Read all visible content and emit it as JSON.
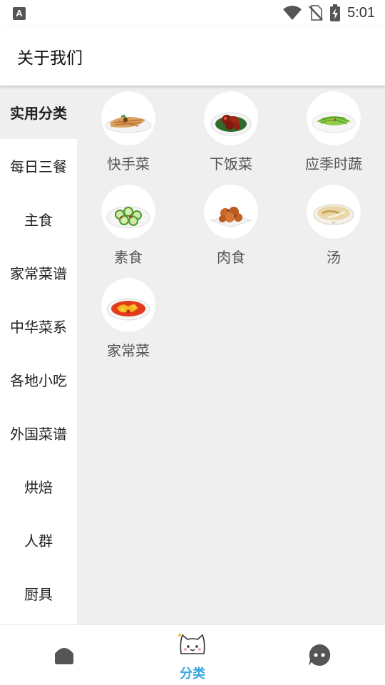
{
  "status": {
    "time": "5:01",
    "notification": "A"
  },
  "appbar": {
    "title": "关于我们"
  },
  "sidebar": {
    "items": [
      {
        "label": "实用分类",
        "active": true
      },
      {
        "label": "每日三餐",
        "active": false
      },
      {
        "label": "主食",
        "active": false
      },
      {
        "label": "家常菜谱",
        "active": false
      },
      {
        "label": "中华菜系",
        "active": false
      },
      {
        "label": "各地小吃",
        "active": false
      },
      {
        "label": "外国菜谱",
        "active": false
      },
      {
        "label": "烘焙",
        "active": false
      },
      {
        "label": "人群",
        "active": false
      },
      {
        "label": "厨具",
        "active": false
      }
    ]
  },
  "categories": [
    {
      "label": "快手菜",
      "icon": "fried-noodles-dish"
    },
    {
      "label": "下饭菜",
      "icon": "braised-pork-dish"
    },
    {
      "label": "应季时蔬",
      "icon": "green-vegetable-dish"
    },
    {
      "label": "素食",
      "icon": "cucumber-dish"
    },
    {
      "label": "肉食",
      "icon": "fried-meat-dish"
    },
    {
      "label": "汤",
      "icon": "soup-dish"
    },
    {
      "label": "家常菜",
      "icon": "tomato-egg-dish"
    }
  ],
  "bottom_nav": {
    "items": [
      {
        "label": "",
        "icon": "home-icon"
      },
      {
        "label": "分类",
        "icon": "cat-icon",
        "active": true
      },
      {
        "label": "",
        "icon": "chat-icon"
      }
    ]
  },
  "colors": {
    "accent": "#3aa6e0",
    "active_bg": "#efefef",
    "nav_icon": "#555555"
  }
}
